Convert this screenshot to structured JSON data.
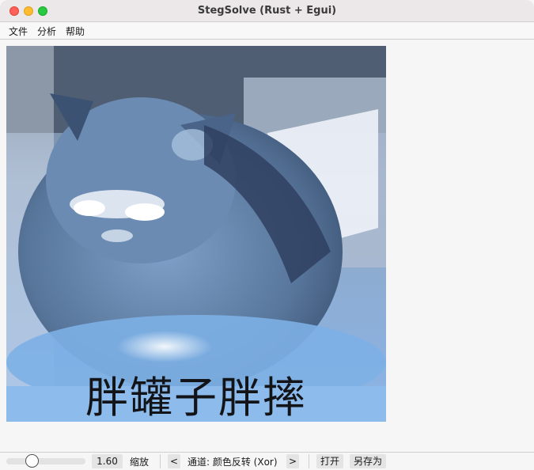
{
  "window": {
    "title": "StegSolve (Rust + Egui)"
  },
  "menu": {
    "items": [
      "文件",
      "分析",
      "帮助"
    ]
  },
  "image": {
    "caption": "胖罐子胖摔"
  },
  "status": {
    "zoom_value": "1.60",
    "zoom_label": "缩放",
    "prev_label": "<",
    "channel_text": "通道: 颜色反转 (Xor)",
    "next_label": ">",
    "open_label": "打开",
    "save_as_label": "另存为"
  },
  "colors": {
    "titlebar": "#ece7e9",
    "close": "#fe5f57",
    "minimize": "#febc2e",
    "maximize": "#28c840"
  }
}
